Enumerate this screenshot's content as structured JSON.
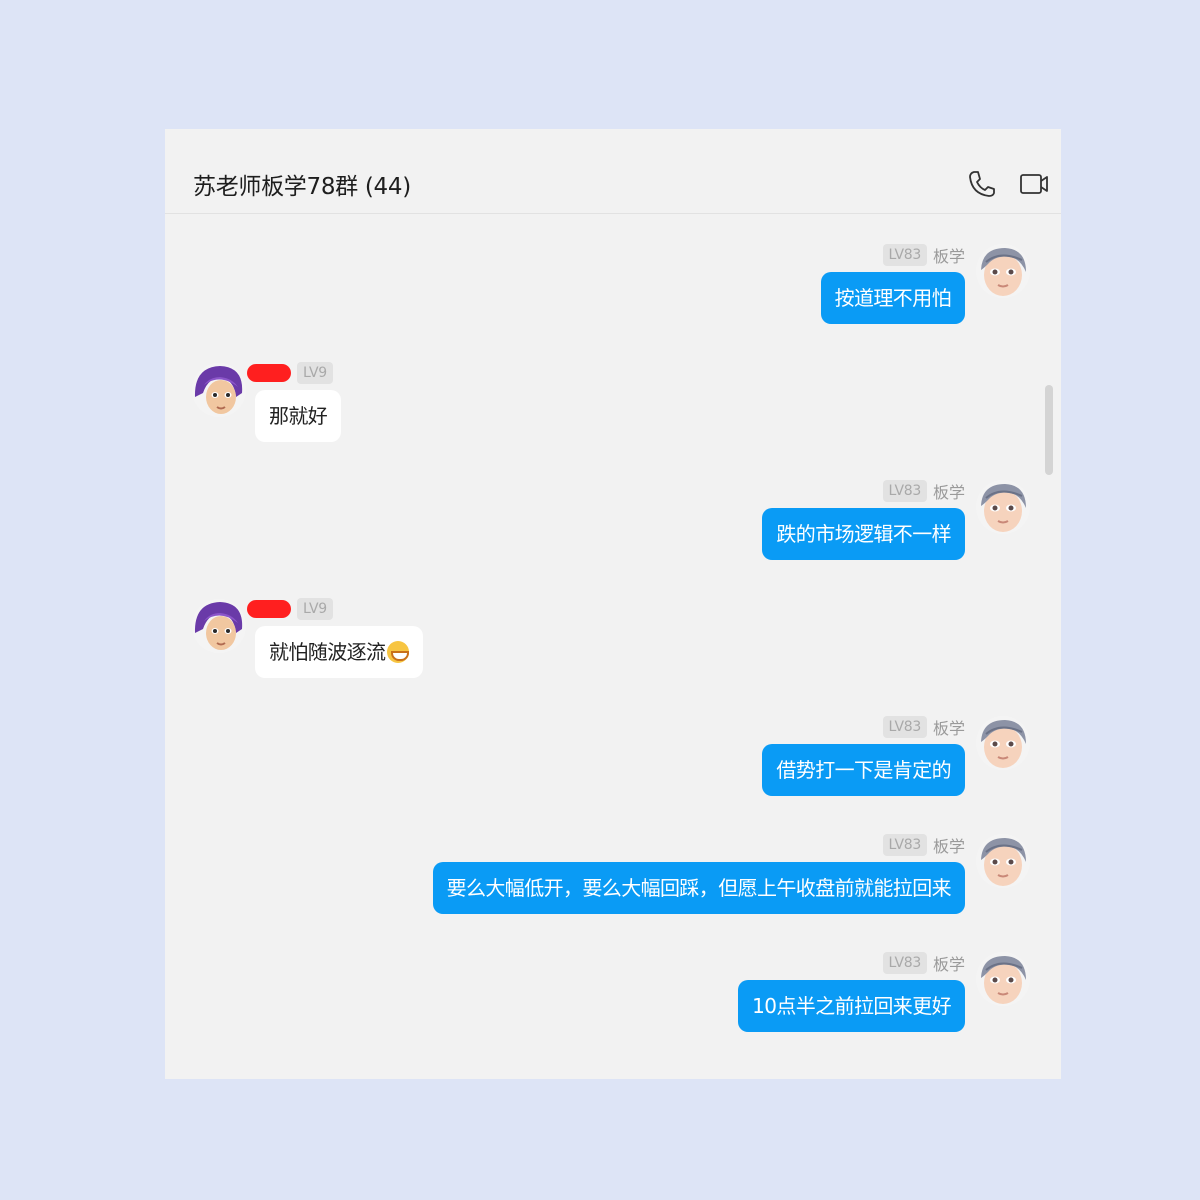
{
  "chat": {
    "title": "苏老师板学78群 (44)",
    "header_icons": [
      "phone-icon",
      "video-icon"
    ]
  },
  "colors": {
    "page_background": "#dde4f6",
    "window_background": "#f2f2f2",
    "outgoing_bubble": "#0a9bf5",
    "incoming_bubble": "#ffffff",
    "redaction": "#ff1f1f"
  },
  "messages": [
    {
      "direction": "outgoing",
      "level": "LV83",
      "role": "板学",
      "text": "按道理不用怕"
    },
    {
      "direction": "incoming",
      "level": "LV9",
      "name_redacted": true,
      "text": "那就好"
    },
    {
      "direction": "outgoing",
      "level": "LV83",
      "role": "板学",
      "text": "跌的市场逻辑不一样"
    },
    {
      "direction": "incoming",
      "level": "LV9",
      "name_redacted": true,
      "text": "就怕随波逐流",
      "emoji": "grin-emoji"
    },
    {
      "direction": "outgoing",
      "level": "LV83",
      "role": "板学",
      "text": "借势打一下是肯定的"
    },
    {
      "direction": "outgoing",
      "level": "LV83",
      "role": "板学",
      "text": "要么大幅低开，要么大幅回踩，但愿上午收盘前就能拉回来"
    },
    {
      "direction": "outgoing",
      "level": "LV83",
      "role": "板学",
      "text": "10点半之前拉回来更好"
    }
  ]
}
